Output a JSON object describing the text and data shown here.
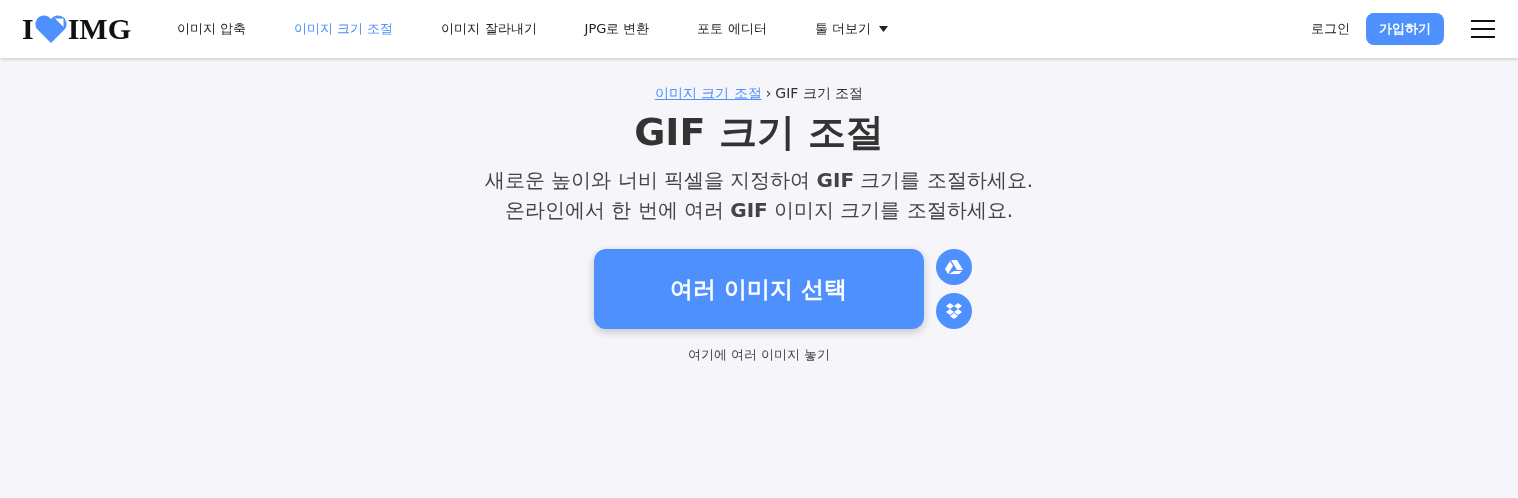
{
  "logo": {
    "left": "I",
    "right": "IMG"
  },
  "nav": [
    {
      "label": "이미지 압축",
      "selected": false,
      "kind": "link"
    },
    {
      "label": "이미지 크기 조절",
      "selected": true,
      "kind": "link"
    },
    {
      "label": "이미지 잘라내기",
      "selected": false,
      "kind": "link"
    },
    {
      "label": "JPG로 변환",
      "selected": false,
      "kind": "link"
    },
    {
      "label": "포토 에디터",
      "selected": false,
      "kind": "link"
    },
    {
      "label": "툴 더보기",
      "selected": false,
      "kind": "dropdown"
    }
  ],
  "login": "로그인",
  "signup": "가입하기",
  "breadcrumb_separator": "›",
  "breadcrumb": [
    {
      "label": "이미지 크기 조절",
      "kind": "link"
    },
    {
      "label": "GIF 크기 조절",
      "kind": "text"
    }
  ],
  "title": "GIF 크기 조절",
  "subtitle": [
    "새로운 높이와 너비 픽셀을 지정하여 **GIF** 크기를 조절하세요.",
    "온라인에서 한 번에 여러 **GIF** 이미지 크기를 조절하세요."
  ],
  "upload_button": "여러 이미지 선택",
  "drop_hint": "여기에 여러 이미지 놓기"
}
